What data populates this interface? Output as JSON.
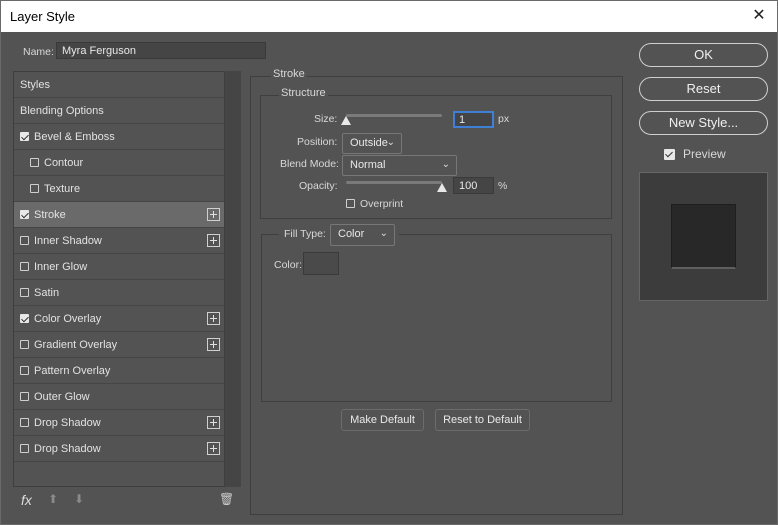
{
  "window": {
    "title": "Layer Style",
    "close_glyph": "✕"
  },
  "name_field": {
    "label": "Name:",
    "value": "Myra Ferguson"
  },
  "styles_list": [
    {
      "label": "Styles",
      "checkbox": false,
      "checked": false,
      "indent": false,
      "plus": false,
      "selected": false
    },
    {
      "label": "Blending Options",
      "checkbox": false,
      "checked": false,
      "indent": false,
      "plus": false,
      "selected": false
    },
    {
      "label": "Bevel & Emboss",
      "checkbox": true,
      "checked": true,
      "indent": false,
      "plus": false,
      "selected": false
    },
    {
      "label": "Contour",
      "checkbox": true,
      "checked": false,
      "indent": true,
      "plus": false,
      "selected": false
    },
    {
      "label": "Texture",
      "checkbox": true,
      "checked": false,
      "indent": true,
      "plus": false,
      "selected": false
    },
    {
      "label": "Stroke",
      "checkbox": true,
      "checked": true,
      "indent": false,
      "plus": true,
      "selected": true
    },
    {
      "label": "Inner Shadow",
      "checkbox": true,
      "checked": false,
      "indent": false,
      "plus": true,
      "selected": false
    },
    {
      "label": "Inner Glow",
      "checkbox": true,
      "checked": false,
      "indent": false,
      "plus": false,
      "selected": false
    },
    {
      "label": "Satin",
      "checkbox": true,
      "checked": false,
      "indent": false,
      "plus": false,
      "selected": false
    },
    {
      "label": "Color Overlay",
      "checkbox": true,
      "checked": true,
      "indent": false,
      "plus": true,
      "selected": false
    },
    {
      "label": "Gradient Overlay",
      "checkbox": true,
      "checked": false,
      "indent": false,
      "plus": true,
      "selected": false
    },
    {
      "label": "Pattern Overlay",
      "checkbox": true,
      "checked": false,
      "indent": false,
      "plus": false,
      "selected": false
    },
    {
      "label": "Outer Glow",
      "checkbox": true,
      "checked": false,
      "indent": false,
      "plus": false,
      "selected": false
    },
    {
      "label": "Drop Shadow",
      "checkbox": true,
      "checked": false,
      "indent": false,
      "plus": true,
      "selected": false
    },
    {
      "label": "Drop Shadow",
      "checkbox": true,
      "checked": false,
      "indent": false,
      "plus": true,
      "selected": false
    }
  ],
  "list_footer": {
    "fx_label": "fx",
    "up_glyph": "⬆",
    "down_glyph": "⬇",
    "trash_glyph": "🗑"
  },
  "stroke": {
    "heading": "Stroke",
    "structure_heading": "Structure",
    "size_label": "Size:",
    "size_value": "1",
    "size_unit": "px",
    "size_level": 0.0,
    "position_label": "Position:",
    "position_value": "Outside",
    "blend_label": "Blend Mode:",
    "blend_value": "Normal",
    "opacity_label": "Opacity:",
    "opacity_value": "100",
    "opacity_unit": "%",
    "opacity_level": 1.0,
    "overprint_label": "Overprint",
    "overprint_checked": false,
    "fill_type_label": "Fill Type:",
    "fill_type_value": "Color",
    "color_label": "Color:",
    "color_swatch": "#4a4a4a",
    "make_default": "Make Default",
    "reset_to_default": "Reset to Default"
  },
  "right": {
    "ok": "OK",
    "reset": "Reset",
    "new_style": "New Style...",
    "preview_label": "Preview",
    "preview_checked": true
  },
  "colors": {
    "bg": "#535353",
    "selected": "#6a6a6a",
    "preview_bg": "#3c3c3c",
    "preview_square": "#282828"
  }
}
